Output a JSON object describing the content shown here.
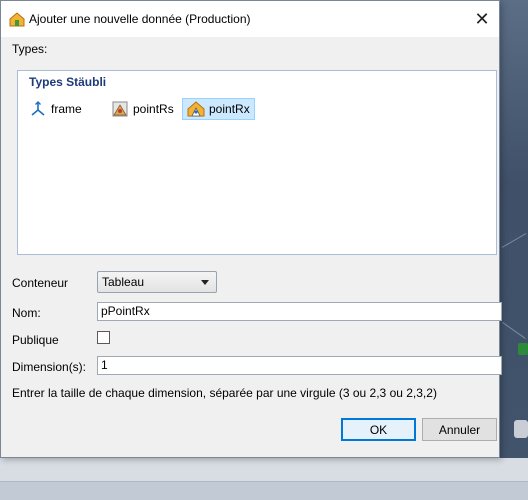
{
  "dialog": {
    "title": "Ajouter une nouvelle donnée (Production)",
    "close_symbol": "✕"
  },
  "types": {
    "label": "Types:",
    "group_title": "Types Stäubli",
    "items": [
      {
        "label": "frame",
        "icon": "frame-icon",
        "selected": false
      },
      {
        "label": "pointRs",
        "icon": "pointrs-icon",
        "selected": false
      },
      {
        "label": "pointRx",
        "icon": "pointrx-icon",
        "selected": true
      }
    ]
  },
  "form": {
    "container_label": "Conteneur",
    "container_value": "Tableau",
    "name_label": "Nom:",
    "name_value": "pPointRx",
    "public_label": "Publique",
    "public_checked": false,
    "dimension_label": "Dimension(s):",
    "dimension_value": "1",
    "hint": "Entrer la taille de chaque dimension, séparée par une virgule (3 ou 2,3 ou 2,3,2)"
  },
  "buttons": {
    "ok": "OK",
    "cancel": "Annuler"
  },
  "colors": {
    "group_title": "#1e3a78",
    "selection": "#cce8ff",
    "default_button_border": "#0078d7"
  }
}
